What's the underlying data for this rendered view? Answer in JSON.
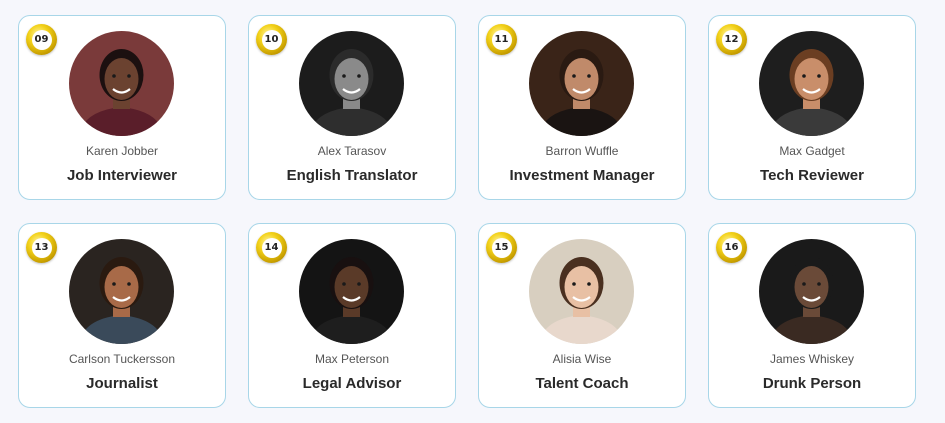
{
  "cards": [
    {
      "number": "09",
      "name": "Karen Jobber",
      "role": "Job Interviewer",
      "avatar_icon": "woman-curly-hair-portrait",
      "bg": "#7a3a3a",
      "skin": "#6b4230",
      "hair": "#1c1010",
      "cloth": "#5a1e2a"
    },
    {
      "number": "10",
      "name": "Alex Tarasov",
      "role": "English Translator",
      "avatar_icon": "man-cap-portrait",
      "bg": "#1c1c1c",
      "skin": "#8a8a8a",
      "hair": "#2b2b2b",
      "cloth": "#2e2e2e"
    },
    {
      "number": "11",
      "name": "Barron Wuffle",
      "role": "Investment Manager",
      "avatar_icon": "man-tuxedo-portrait",
      "bg": "#3a2418",
      "skin": "#c08a6a",
      "hair": "#2a1a12",
      "cloth": "#1a1412"
    },
    {
      "number": "12",
      "name": "Max Gadget",
      "role": "Tech Reviewer",
      "avatar_icon": "man-smiling-portrait",
      "bg": "#1e1e1e",
      "skin": "#c98e6a",
      "hair": "#6b3e22",
      "cloth": "#3a3a3a"
    },
    {
      "number": "13",
      "name": "Carlson Tuckersson",
      "role": "Journalist",
      "avatar_icon": "man-curly-hair-portrait",
      "bg": "#2a2420",
      "skin": "#a86a48",
      "hair": "#2a1a10",
      "cloth": "#3a4a5a"
    },
    {
      "number": "14",
      "name": "Max Peterson",
      "role": "Legal Advisor",
      "avatar_icon": "man-suit-portrait",
      "bg": "#141414",
      "skin": "#5a3a28",
      "hair": "#181010",
      "cloth": "#1e1e1e"
    },
    {
      "number": "15",
      "name": "Alisia Wise",
      "role": "Talent Coach",
      "avatar_icon": "woman-long-hair-portrait",
      "bg": "#d8cfc0",
      "skin": "#e8c0a4",
      "hair": "#4a3020",
      "cloth": "#e8d8cc"
    },
    {
      "number": "16",
      "name": "James Whiskey",
      "role": "Drunk Person",
      "avatar_icon": "man-hoodie-portrait",
      "bg": "#1a1a1a",
      "skin": "#6a4a38",
      "hair": "#1a1a1a",
      "cloth": "#3a2a22"
    }
  ]
}
